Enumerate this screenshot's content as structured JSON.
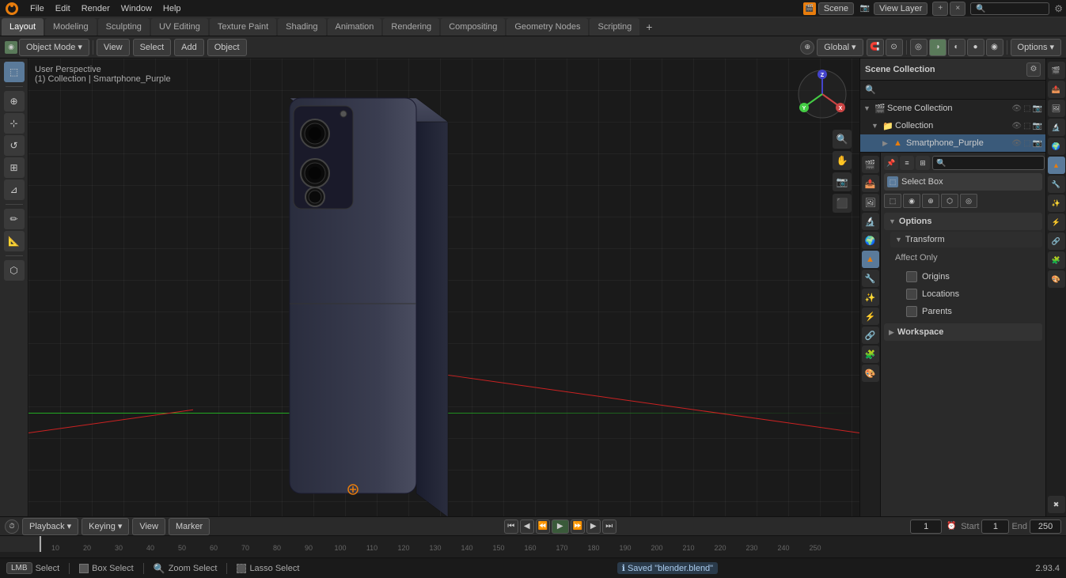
{
  "topbar": {
    "menus": [
      "File",
      "Edit",
      "Render",
      "Window",
      "Help"
    ],
    "logo": "⬡"
  },
  "workspace_tabs": {
    "tabs": [
      "Layout",
      "Modeling",
      "Sculpting",
      "UV Editing",
      "Texture Paint",
      "Shading",
      "Animation",
      "Rendering",
      "Compositing",
      "Geometry Nodes",
      "Scripting"
    ],
    "active": "Layout",
    "add_label": "+"
  },
  "toolbar": {
    "mode": "Object Mode",
    "view": "View",
    "select": "Select",
    "add": "Add",
    "object": "Object",
    "transform": "Global",
    "options_label": "Options"
  },
  "viewport": {
    "info_line1": "User Perspective",
    "info_line2": "(1) Collection | Smartphone_Purple",
    "gizmo_x": "X",
    "gizmo_y": "Y",
    "gizmo_z": "Z"
  },
  "outliner": {
    "title": "Scene Collection",
    "search_placeholder": "🔍",
    "items": [
      {
        "label": "Scene Collection",
        "level": 0,
        "icon": "🎬",
        "expanded": true
      },
      {
        "label": "Collection",
        "level": 1,
        "icon": "📁",
        "expanded": true
      },
      {
        "label": "Smartphone_Purple",
        "level": 2,
        "icon": "📱",
        "expanded": false,
        "selected": true
      }
    ]
  },
  "properties": {
    "sections": {
      "options_label": "Options",
      "transform_label": "Transform",
      "affect_only_label": "Affect Only",
      "origins_label": "Origins",
      "locations_label": "Locations",
      "parents_label": "Parents",
      "workspace_label": "Workspace"
    }
  },
  "timeline": {
    "playback": "Playback",
    "keying": "Keying",
    "view": "View",
    "marker": "Marker",
    "frame_current": "1",
    "frame_start_label": "Start",
    "frame_start": "1",
    "frame_end_label": "End",
    "frame_end": "250",
    "ruler_marks": [
      "10",
      "20",
      "30",
      "40",
      "50",
      "60",
      "70",
      "80",
      "90",
      "100",
      "110",
      "120",
      "130",
      "140",
      "150",
      "160",
      "170",
      "180",
      "190",
      "200",
      "210",
      "220",
      "230",
      "240",
      "250"
    ]
  },
  "statusbar": {
    "select_label": "Select",
    "box_select_label": "Box Select",
    "zoom_select_label": "Zoom Select",
    "lasso_select_label": "Lasso Select",
    "saved_message": "Saved \"blender.blend\"",
    "coords": "2.93.4"
  },
  "right_props_icons": [
    {
      "icon": "🎬",
      "label": "render-icon"
    },
    {
      "icon": "📤",
      "label": "output-icon"
    },
    {
      "icon": "🖼️",
      "label": "view-layer-icon"
    },
    {
      "icon": "🔬",
      "label": "scene-icon"
    },
    {
      "icon": "🌍",
      "label": "world-icon"
    },
    {
      "icon": "⚙️",
      "label": "object-icon"
    },
    {
      "icon": "🔧",
      "label": "modifier-icon"
    },
    {
      "icon": "✨",
      "label": "particles-icon"
    },
    {
      "icon": "⚡",
      "label": "physics-icon"
    },
    {
      "icon": "🔗",
      "label": "constraints-icon"
    },
    {
      "icon": "🧩",
      "label": "data-icon"
    },
    {
      "icon": "🎨",
      "label": "material-icon"
    },
    {
      "icon": "❌",
      "label": "close-icon"
    }
  ],
  "scene_label": "Scene",
  "view_layer_label": "View Layer"
}
